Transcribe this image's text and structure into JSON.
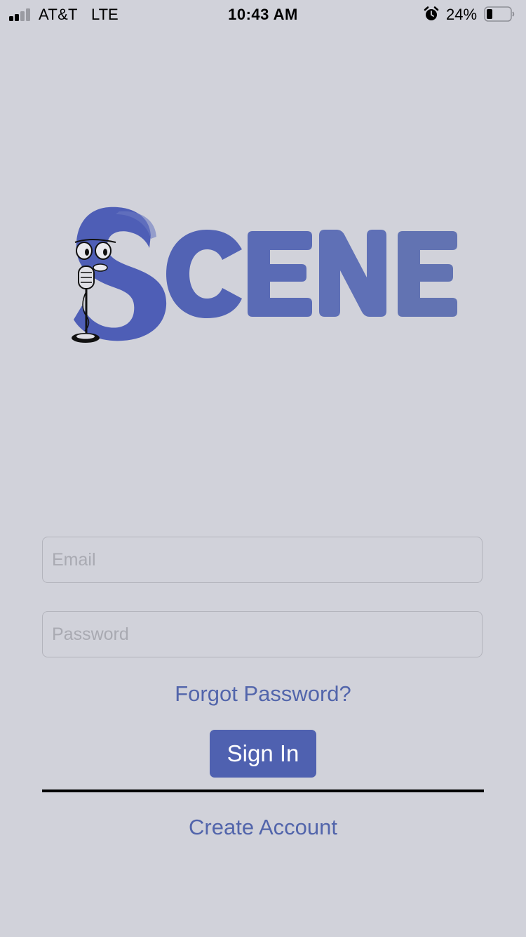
{
  "status_bar": {
    "carrier": "AT&T",
    "network": "LTE",
    "time": "10:43 AM",
    "battery_percent": "24%",
    "icons": [
      "signal-icon",
      "alarm-icon",
      "battery-icon"
    ]
  },
  "logo": {
    "text": "SCENE",
    "icon": "microphone-character-icon",
    "colors": {
      "primary": "#5565b5",
      "secondary": "#6273b4"
    }
  },
  "login_form": {
    "email_placeholder": "Email",
    "password_placeholder": "Password",
    "forgot_password_label": "Forgot Password?",
    "sign_in_label": "Sign In",
    "create_account_label": "Create Account"
  },
  "colors": {
    "background": "#d1d2da",
    "accent": "#4f61b0",
    "link": "#5265ab"
  }
}
